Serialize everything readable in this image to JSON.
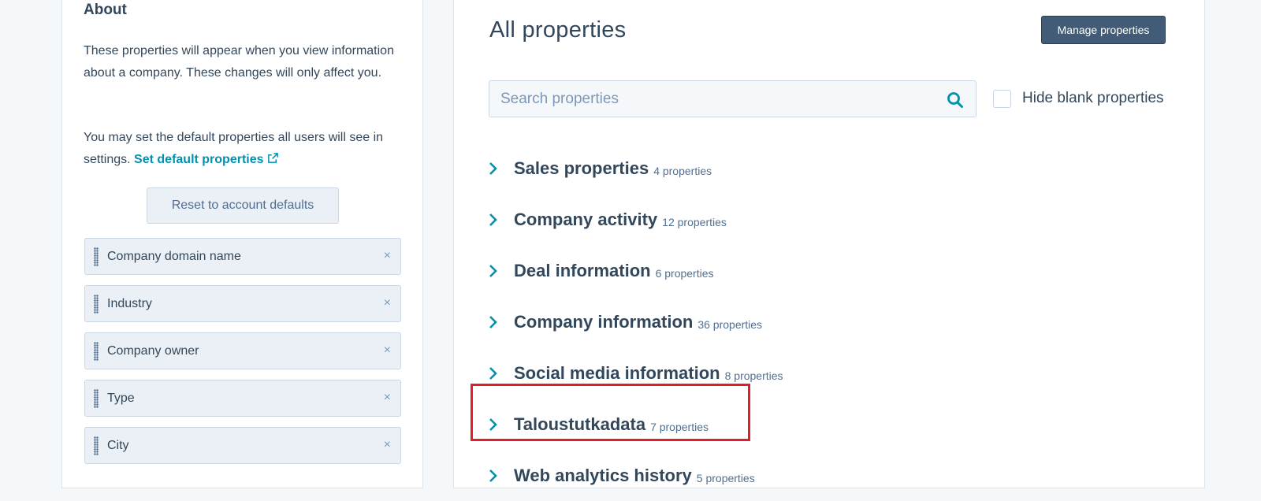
{
  "about": {
    "title": "About",
    "description": "These properties will appear when you view information about a company. These changes will only affect you.",
    "default_text": "You may set the default properties all users will see in settings.",
    "default_link": "Set default properties",
    "reset_button": "Reset to account defaults",
    "properties": [
      {
        "label": "Company domain name"
      },
      {
        "label": "Industry"
      },
      {
        "label": "Company owner"
      },
      {
        "label": "Type"
      },
      {
        "label": "City"
      }
    ],
    "remove_glyph": "×"
  },
  "all_properties": {
    "title": "All properties",
    "manage_button": "Manage properties",
    "search": {
      "placeholder": "Search properties",
      "value": ""
    },
    "hide_blank_label": "Hide blank properties",
    "hide_blank_checked": false,
    "groups": [
      {
        "name": "Sales properties",
        "count": "4 properties"
      },
      {
        "name": "Company activity",
        "count": "12 properties"
      },
      {
        "name": "Deal information",
        "count": "6 properties"
      },
      {
        "name": "Company information",
        "count": "36 properties"
      },
      {
        "name": "Social media information",
        "count": "8 properties"
      },
      {
        "name": "Taloustutkadata",
        "count": "7 properties",
        "highlighted": true
      },
      {
        "name": "Web analytics history",
        "count": "5 properties"
      }
    ]
  },
  "colors": {
    "accent_link": "#0091ae",
    "highlight_border": "#e01e2a",
    "primary_button": "#425b76"
  },
  "icons": {
    "external_link": "external-link-icon",
    "search": "search-icon",
    "chevron": "chevron-right-icon",
    "drag": "drag-handle-icon",
    "remove": "close-icon"
  }
}
